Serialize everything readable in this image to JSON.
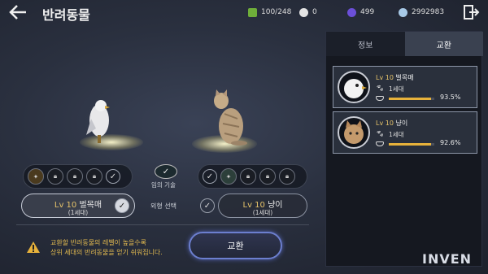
{
  "header": {
    "title": "반려동물",
    "resources": [
      {
        "name": "capacity",
        "value": "100/248",
        "color": "#6fae3a"
      },
      {
        "name": "pearl",
        "value": "0",
        "color": "#e4e4e4"
      },
      {
        "name": "purple-crystal",
        "value": "499",
        "color": "#6b4fd8"
      },
      {
        "name": "silver",
        "value": "2992983",
        "color": "#a7c9e6"
      }
    ]
  },
  "tabs": [
    {
      "label": "정보",
      "active": false
    },
    {
      "label": "교환",
      "active": true
    }
  ],
  "pet_list": [
    {
      "lv": "Lv 10",
      "name": "벌목매",
      "generation": "1세대",
      "progress_pct": 93.5,
      "pct_label": "93.5%"
    },
    {
      "lv": "Lv 10",
      "name": "냥이",
      "generation": "1세대",
      "progress_pct": 92.6,
      "pct_label": "92.6%"
    }
  ],
  "left_pet": {
    "lv": "Lv 10",
    "name": "벌목매",
    "generation": "(1세대)"
  },
  "right_pet": {
    "lv": "Lv 10",
    "name": "냥이",
    "generation": "(1세대)"
  },
  "skill_label": "임의 기술",
  "appearance_label": "외형 선택",
  "notice_line1": "교환할 반려동물의 레벨이 높을수록",
  "notice_line2": "상위 세대의 반려동물을 얻기 쉬워집니다.",
  "exchange_button": "교환",
  "watermark": "INVEN"
}
